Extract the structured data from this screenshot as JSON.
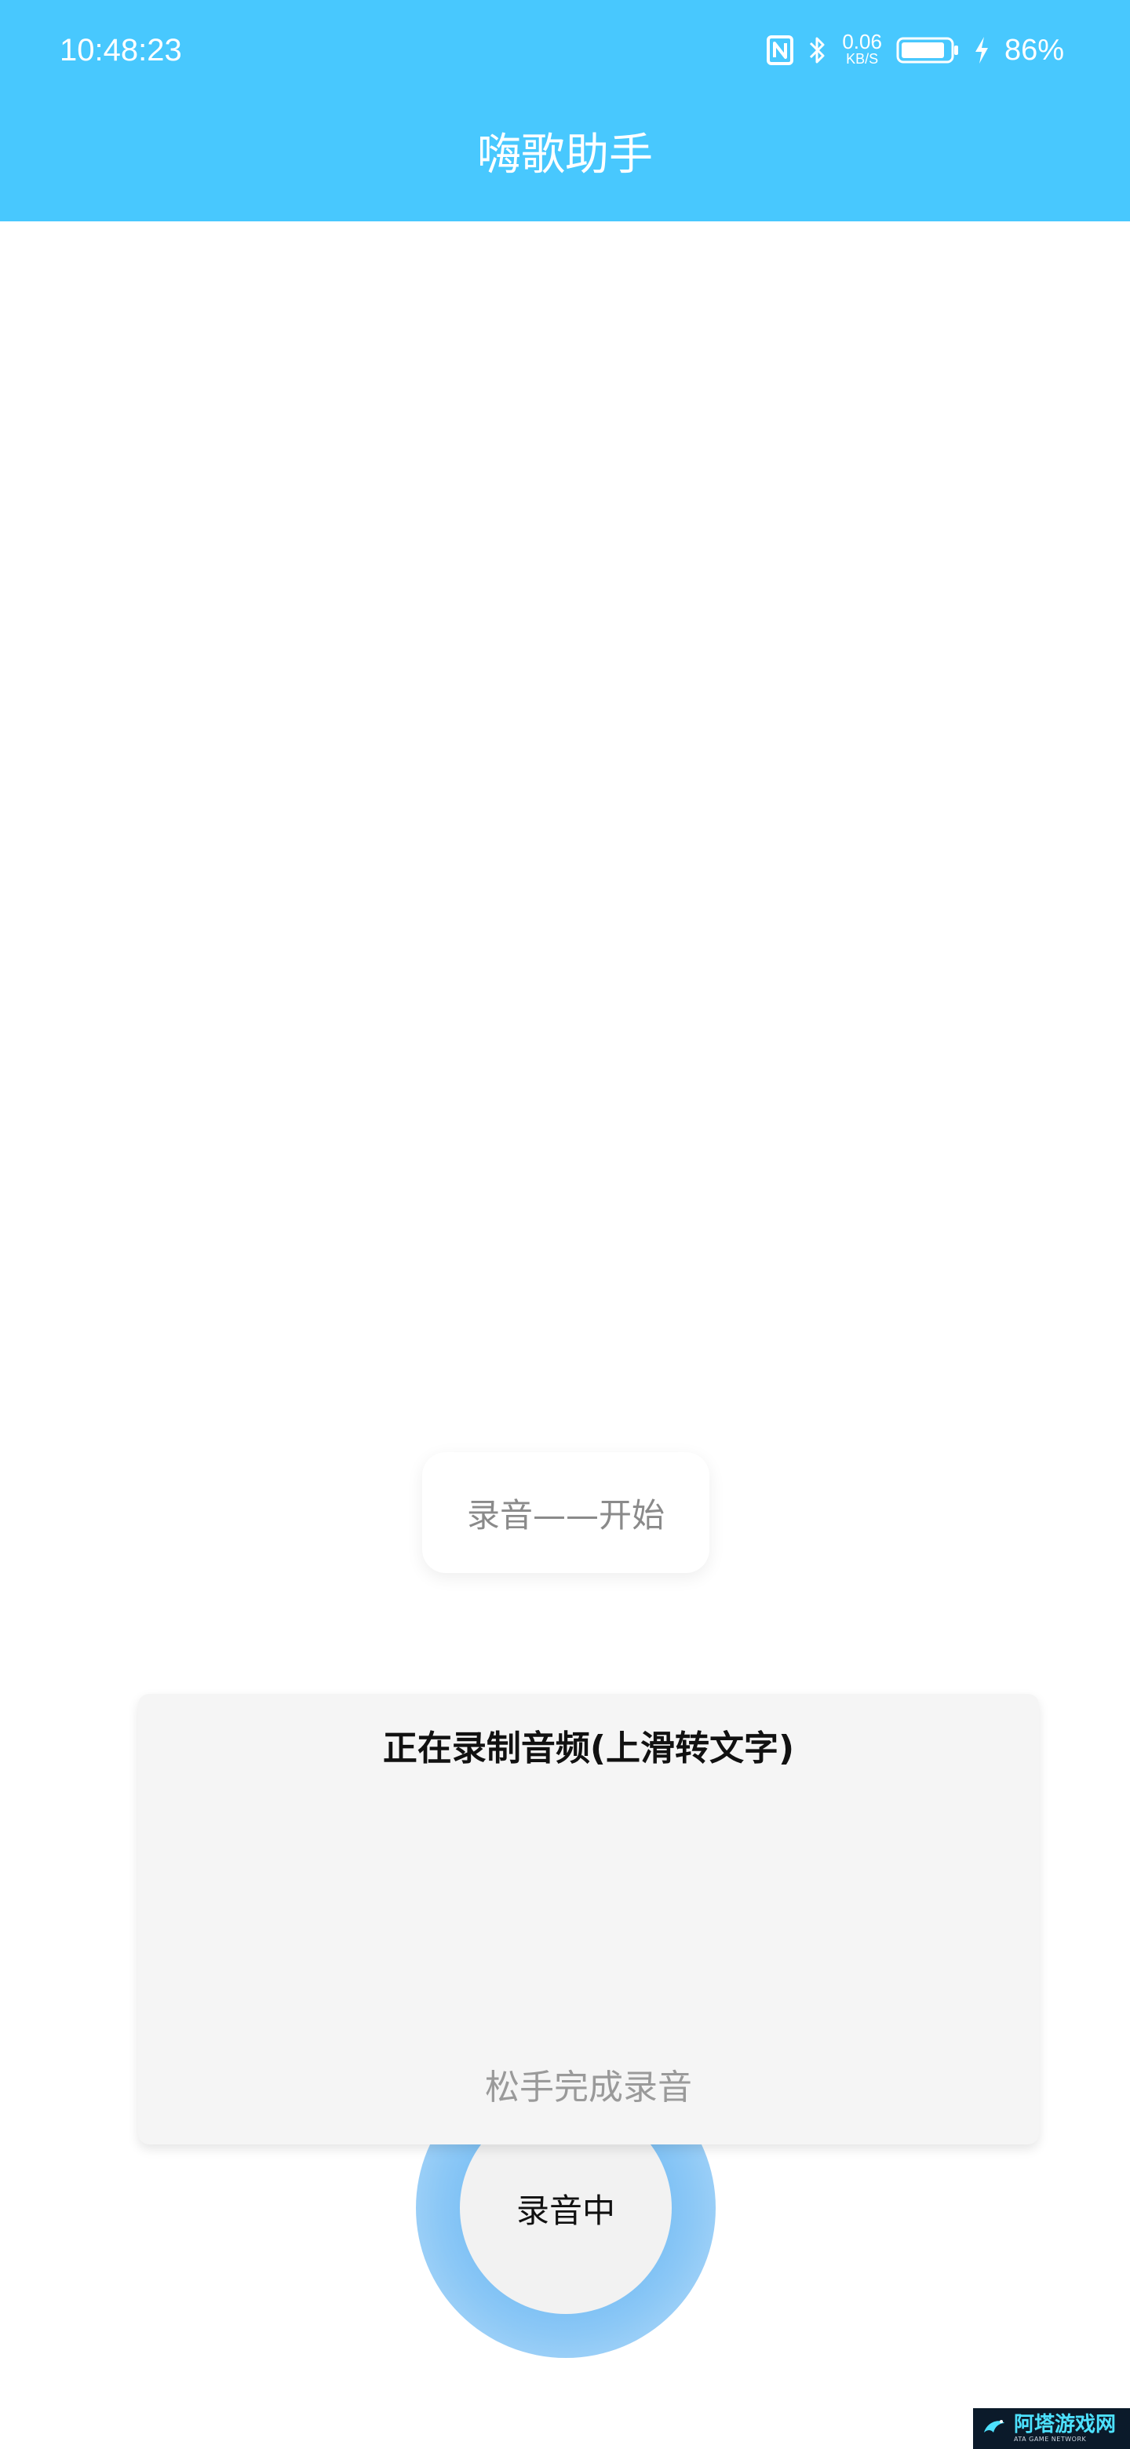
{
  "status_bar": {
    "time": "10:48:23",
    "net_speed_value": "0.06",
    "net_speed_unit": "KB/S",
    "battery_percent": "86%",
    "icons": [
      "nfc-icon",
      "bluetooth-icon",
      "battery-icon",
      "charging-icon"
    ]
  },
  "header": {
    "title": "嗨歌助手",
    "background_color": "#48C8FE"
  },
  "toast": {
    "text": "录音——开始"
  },
  "record_panel": {
    "title": "正在录制音频(上滑转文字)",
    "hint": "松手完成录音",
    "wave_colors": [
      "#B35A7A",
      "#5A5AC8"
    ]
  },
  "record_button": {
    "label": "录音中"
  },
  "watermark": {
    "main": "阿塔游戏网",
    "sub": "ATA GAME NETWORK"
  }
}
